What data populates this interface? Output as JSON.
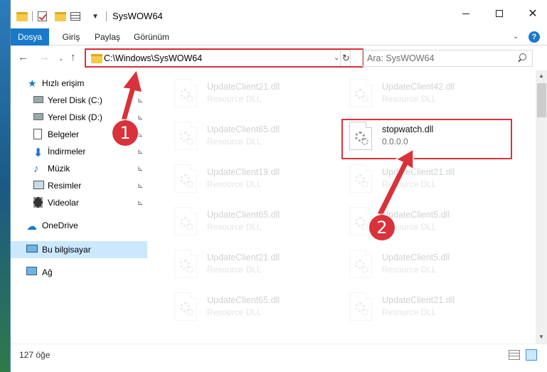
{
  "window": {
    "title": "SysWOW64",
    "minimize": "—",
    "maximize": "☐",
    "close": "✕"
  },
  "ribbon": {
    "tabs": [
      "Dosya",
      "Giriş",
      "Paylaş",
      "Görünüm"
    ],
    "help": "?"
  },
  "nav": {
    "back": "←",
    "forward": "→",
    "recent": "⌄",
    "up": "↑",
    "address": "C:\\Windows\\SysWOW64",
    "address_drop": "⌄",
    "refresh": "↻",
    "search_placeholder": "Ara: SysWOW64"
  },
  "sidebar": {
    "items": [
      {
        "label": "Hızlı erişim",
        "icon": "star-icon",
        "pinned": false
      },
      {
        "label": "Yerel Disk (C:)",
        "icon": "drive-icon",
        "pinned": true
      },
      {
        "label": "Yerel Disk (D:)",
        "icon": "drive-icon",
        "pinned": true
      },
      {
        "label": "Belgeler",
        "icon": "documents-icon",
        "pinned": true
      },
      {
        "label": "İndirmeler",
        "icon": "download-icon",
        "pinned": true
      },
      {
        "label": "Müzik",
        "icon": "music-icon",
        "pinned": true
      },
      {
        "label": "Resimler",
        "icon": "pictures-icon",
        "pinned": true
      },
      {
        "label": "Videolar",
        "icon": "video-icon",
        "pinned": true
      },
      {
        "label": "OneDrive",
        "icon": "cloud-icon",
        "pinned": false
      },
      {
        "label": "Bu bilgisayar",
        "icon": "computer-icon",
        "pinned": false
      },
      {
        "label": "Ağ",
        "icon": "network-icon",
        "pinned": false
      }
    ],
    "pin_glyph": "📌"
  },
  "files": [
    {
      "name": "UpdateClient21.dll",
      "desc": "Resource DLL"
    },
    {
      "name": "UpdateClient42.dll",
      "desc": "Resource DLL"
    },
    {
      "name": "UpdateClient65.dll",
      "desc": "Resource DLL"
    },
    {
      "name": "stopwatch.dll",
      "desc": "0.0.0.0"
    },
    {
      "name": "UpdateClient19.dll",
      "desc": "Resource DLL"
    },
    {
      "name": "UpdateClient21.dll",
      "desc": "Resource DLL"
    },
    {
      "name": "UpdateClient65.dll",
      "desc": "Resource DLL"
    },
    {
      "name": "UpdateClient5.dll",
      "desc": "Resource DLL"
    },
    {
      "name": "UpdateClient21.dll",
      "desc": "Resource DLL"
    },
    {
      "name": "UpdateClient5.dll",
      "desc": "Resource DLL"
    },
    {
      "name": "UpdateClient65.dll",
      "desc": "Resource DLL"
    },
    {
      "name": "UpdateClient21.dll",
      "desc": "Resource DLL"
    }
  ],
  "status": {
    "count": "127 öğe"
  },
  "annotations": {
    "step1": "1",
    "step2": "2",
    "color": "#d9323a"
  }
}
